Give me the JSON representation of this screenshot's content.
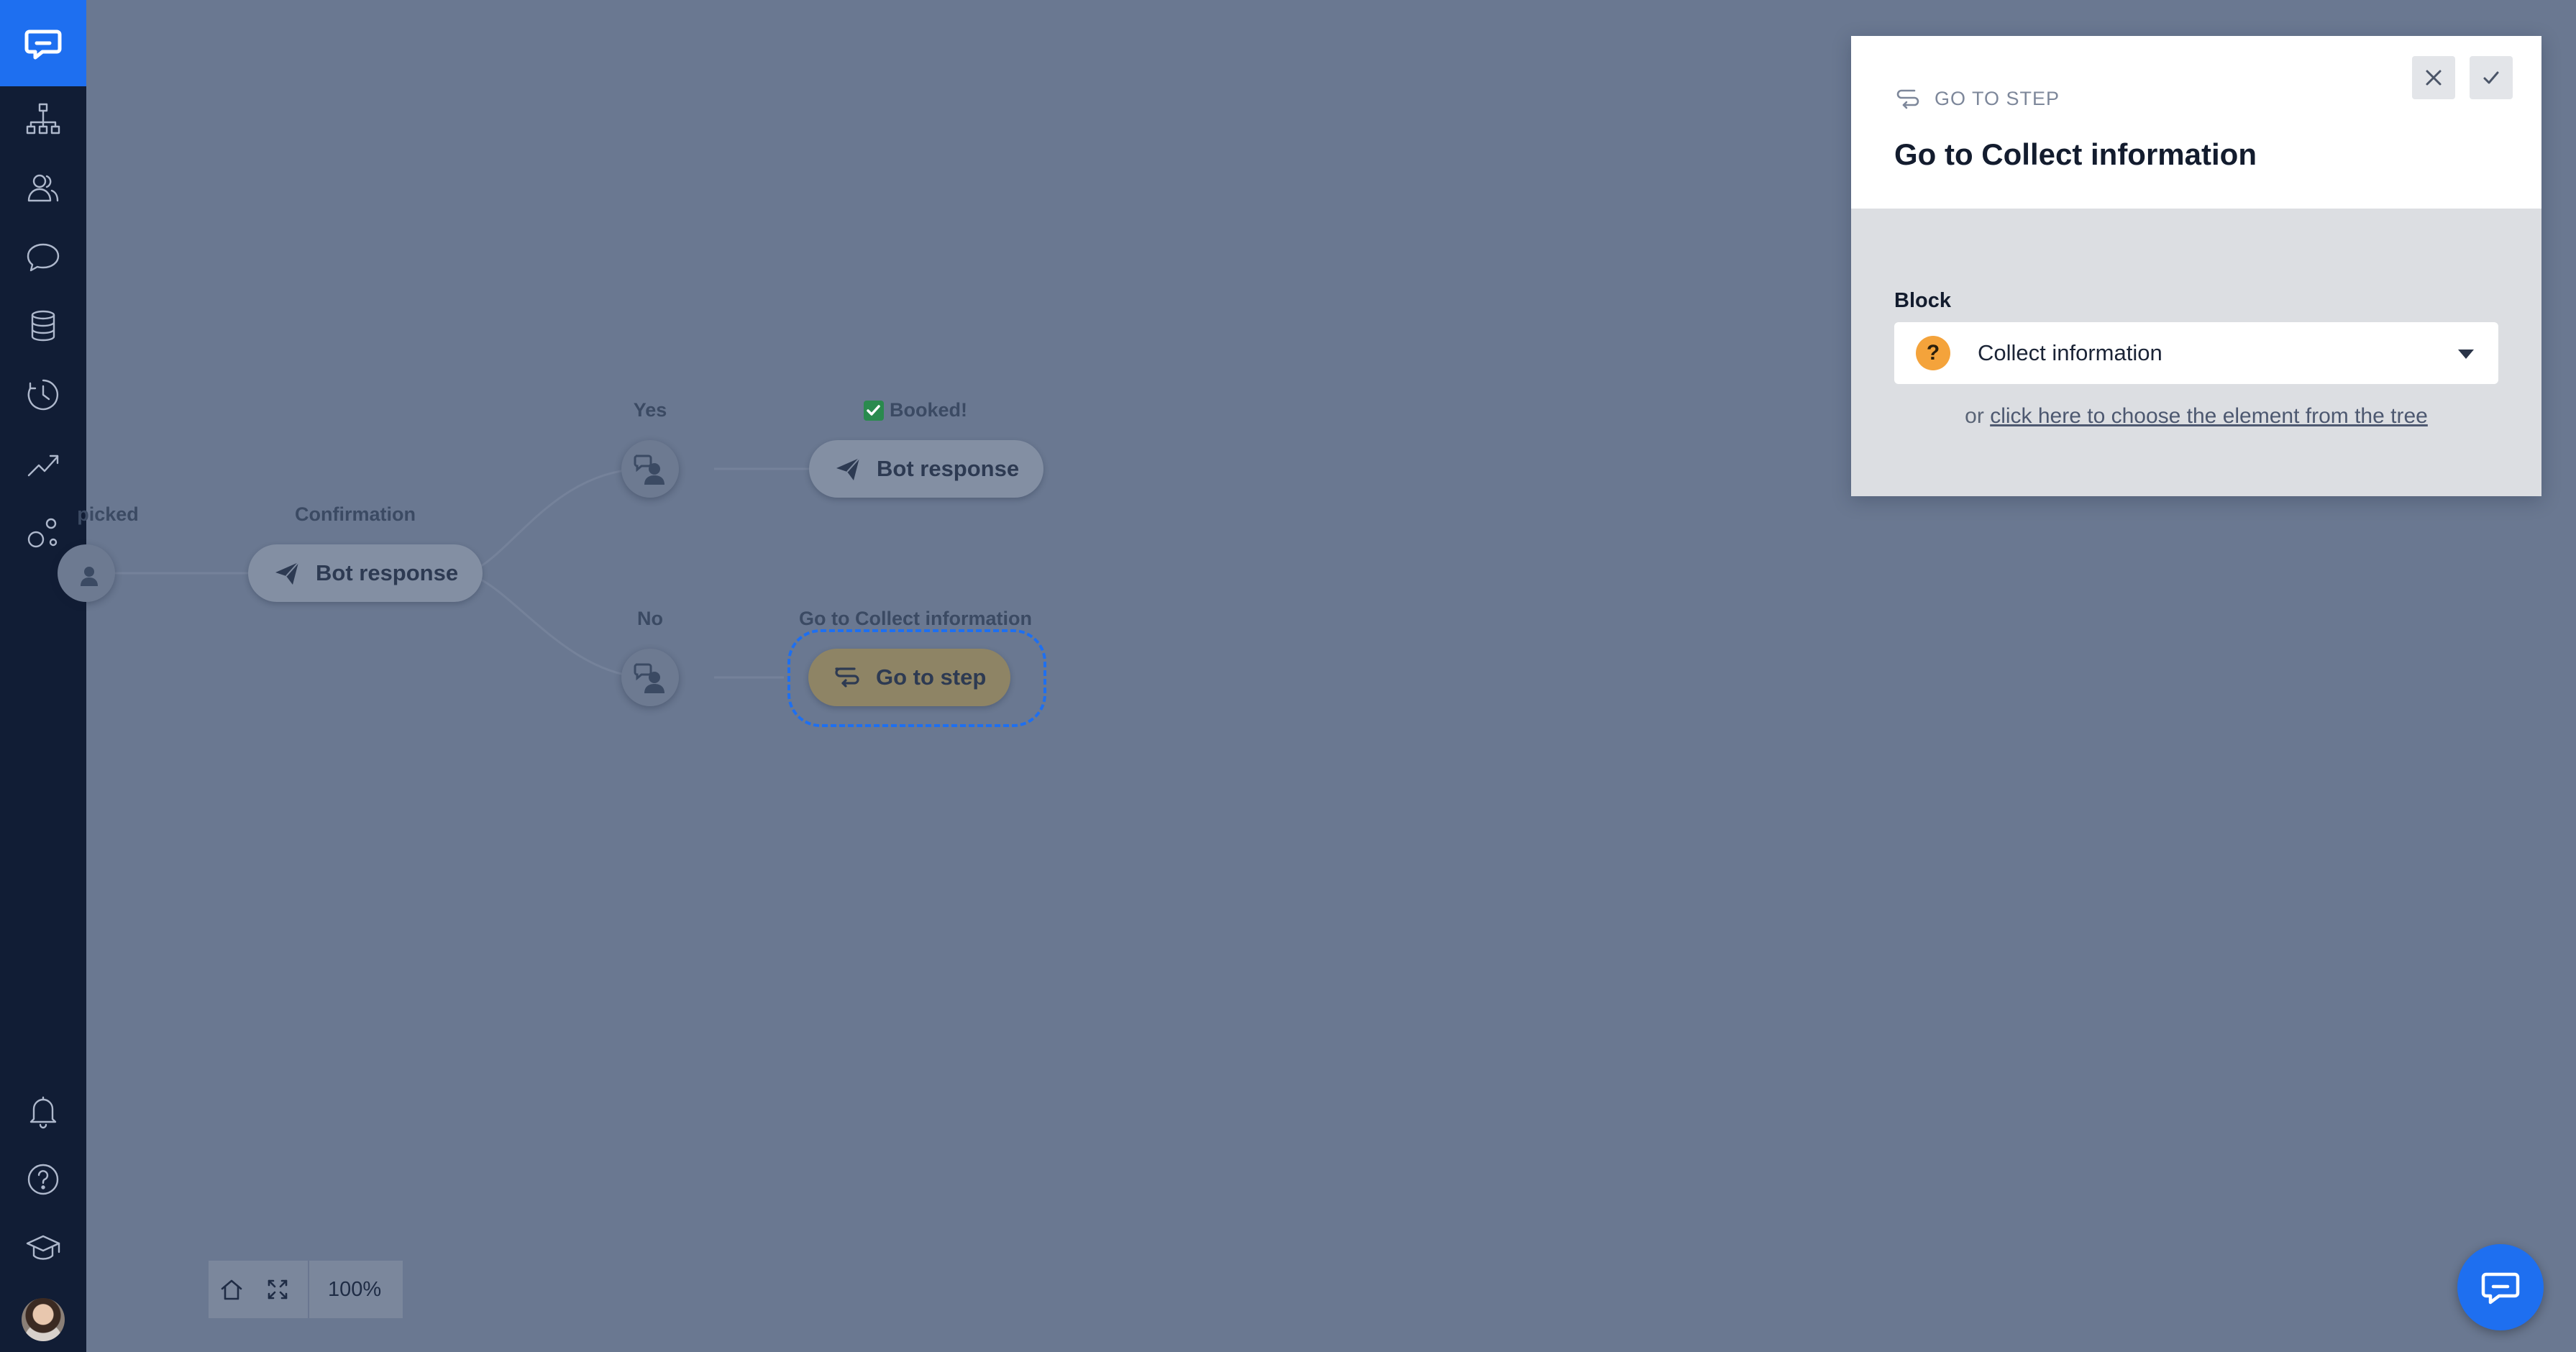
{
  "sidebar": {
    "items": [
      {
        "icon": "flow-tree-icon"
      },
      {
        "icon": "users-icon"
      },
      {
        "icon": "chat-bubble-icon"
      },
      {
        "icon": "database-icon"
      },
      {
        "icon": "history-clock-icon"
      },
      {
        "icon": "analytics-trend-icon"
      },
      {
        "icon": "integrations-icon"
      }
    ],
    "bottom_items": [
      {
        "icon": "bell-icon"
      },
      {
        "icon": "help-icon"
      },
      {
        "icon": "graduation-cap-icon"
      },
      {
        "icon": "avatar"
      }
    ]
  },
  "flow": {
    "labels": {
      "picked": "picked",
      "confirmation": "Confirmation",
      "yes": "Yes",
      "no": "No",
      "booked": "Booked!",
      "go_to_collect": "Go to Collect information"
    },
    "nodes": {
      "bot_response_confirmation": "Bot response",
      "bot_response_booked": "Bot response",
      "go_to_step": "Go to step"
    }
  },
  "zoom": {
    "level": "100%"
  },
  "panel": {
    "kind": "GO TO STEP",
    "title": "Go to Collect information",
    "block_label": "Block",
    "block_value": "Collect information",
    "block_badge": "?",
    "hint_prefix": "or",
    "hint_link": "click here to choose the element from the tree"
  },
  "colors": {
    "brand": "#1e6ff0",
    "sidebar": "#111d35",
    "canvas_overlay": "#6a7891",
    "question_badge": "#f4a33b"
  }
}
